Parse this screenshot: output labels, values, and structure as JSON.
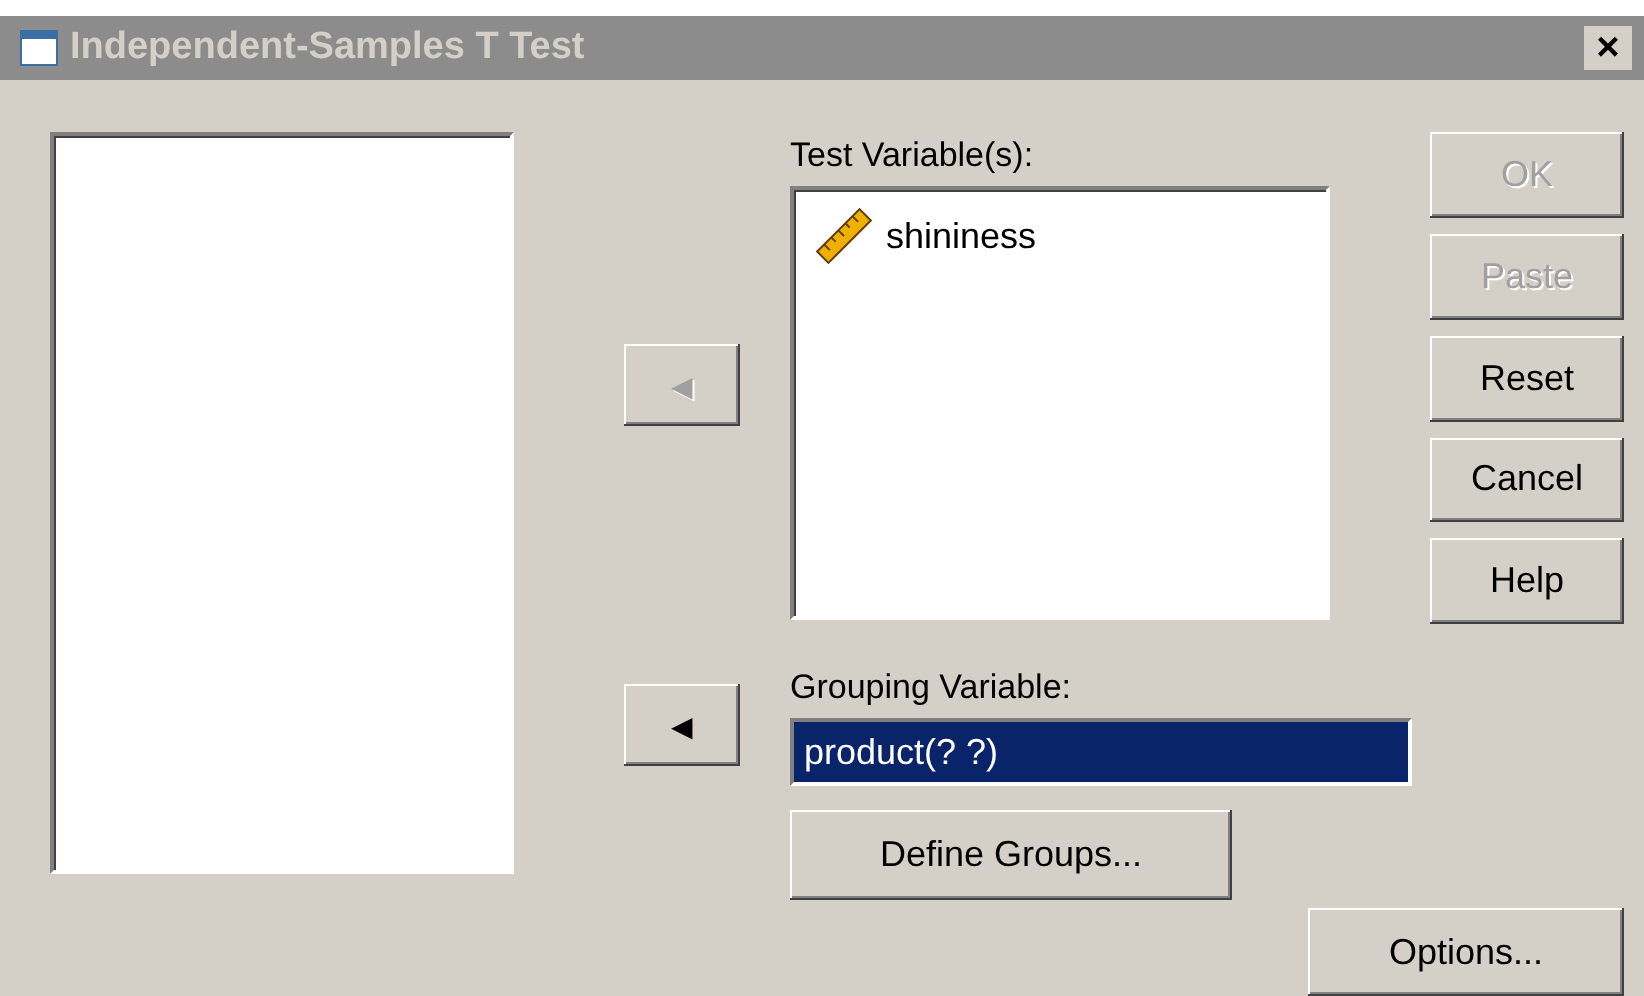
{
  "window": {
    "title": "Independent-Samples T Test",
    "close": "×"
  },
  "move_buttons": [
    {
      "glyph": "◀",
      "disabled": true
    },
    {
      "glyph": "◀",
      "disabled": false
    }
  ],
  "test_variables": {
    "label": "Test Variable(s):",
    "items": [
      {
        "name": "shininess",
        "selected": false
      }
    ]
  },
  "grouping_variable": {
    "label": "Grouping Variable:",
    "value": "product(? ?)",
    "selected": true
  },
  "define_groups": {
    "label": "Define Groups...",
    "disabled": false
  },
  "buttons": [
    {
      "label": "OK",
      "disabled": true
    },
    {
      "label": "Paste",
      "disabled": true
    },
    {
      "label": "Reset",
      "disabled": false
    },
    {
      "label": "Cancel",
      "disabled": false
    },
    {
      "label": "Help",
      "disabled": false
    }
  ],
  "options": {
    "label": "Options...",
    "disabled": false
  }
}
